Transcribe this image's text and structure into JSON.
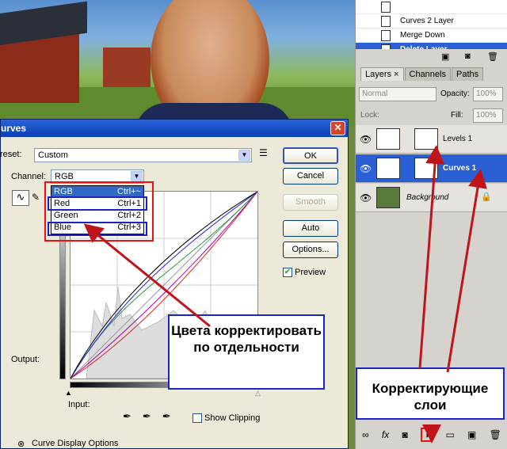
{
  "history": {
    "items": [
      {
        "label": ""
      },
      {
        "label": "Curves 2 Layer"
      },
      {
        "label": "Merge Down"
      },
      {
        "label": "Delete Layer"
      }
    ]
  },
  "layers_panel": {
    "tabs": [
      "Layers ×",
      "Channels",
      "Paths"
    ],
    "blend_mode": "Normal",
    "opacity_label": "Opacity:",
    "opacity_value": "100%",
    "lock_label": "Lock:",
    "fill_label": "Fill:",
    "fill_value": "100%",
    "layers": [
      {
        "name": "Levels 1"
      },
      {
        "name": "Curves 1"
      },
      {
        "name": "Background"
      }
    ],
    "bottom_icons": [
      "link-icon",
      "fx-icon",
      "mask-icon",
      "adjustment-layer-icon",
      "group-icon",
      "new-layer-icon",
      "trash-icon"
    ]
  },
  "dialog": {
    "title": "urves",
    "preset_label": "reset:",
    "preset_value": "Custom",
    "channel_label": "Channel:",
    "channel_value": "RGB",
    "channel_options": [
      {
        "name": "RGB",
        "shortcut": "Ctrl+~"
      },
      {
        "name": "Red",
        "shortcut": "Ctrl+1"
      },
      {
        "name": "Green",
        "shortcut": "Ctrl+2"
      },
      {
        "name": "Blue",
        "shortcut": "Ctrl+3"
      }
    ],
    "buttons": {
      "ok": "OK",
      "cancel": "Cancel",
      "smooth": "Smooth",
      "auto": "Auto",
      "options": "Options..."
    },
    "preview_label": "Preview",
    "output_label": "Output:",
    "input_label": "Input:",
    "show_clipping_label": "Show Clipping",
    "curve_display_options": "Curve Display Options"
  },
  "annotations": {
    "callout_colors": "Цвета корректировать по отдельности",
    "callout_layers": "Корректирующие слои"
  }
}
